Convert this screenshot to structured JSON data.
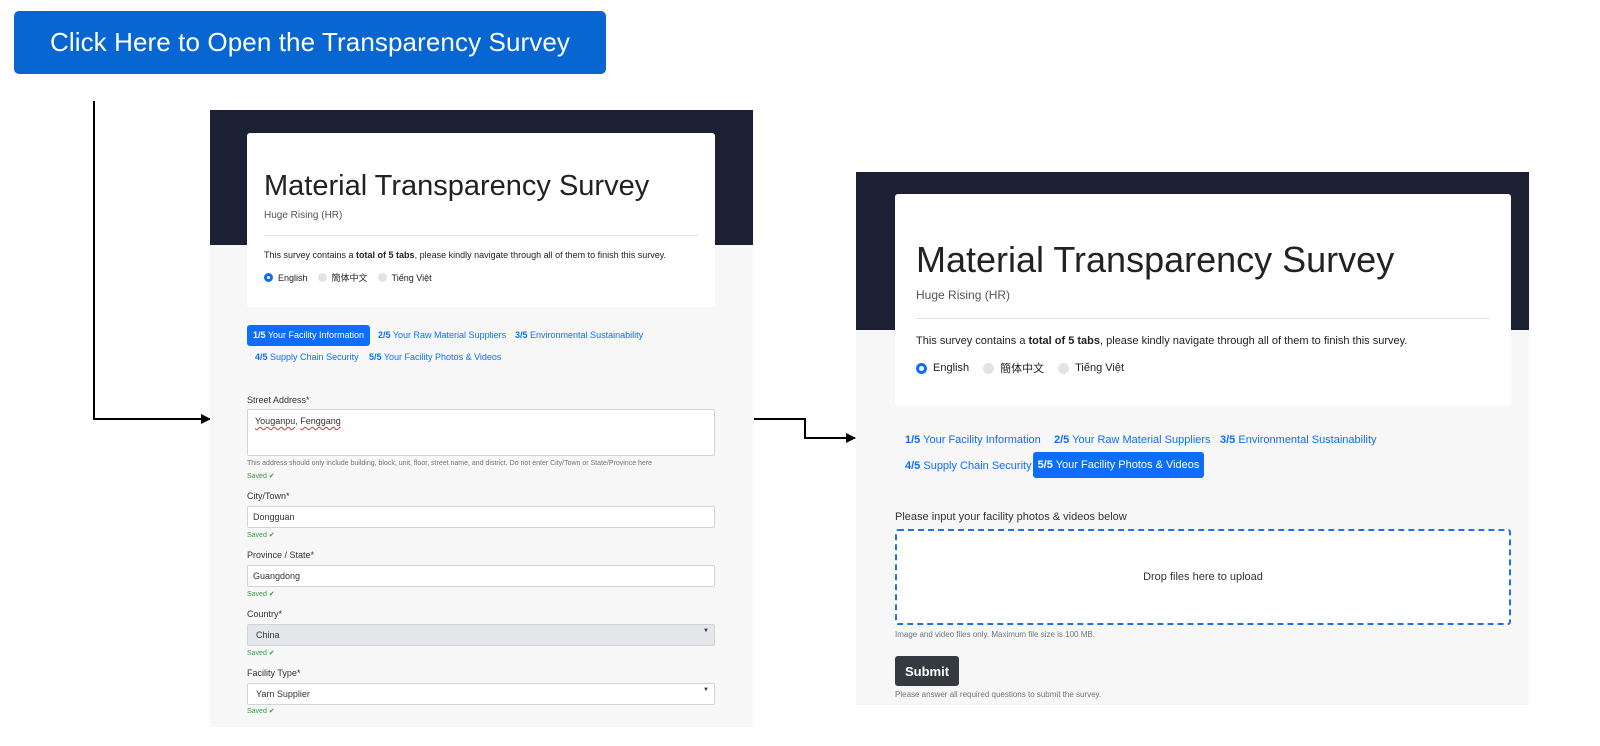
{
  "open_button": "Click Here to Open the Transparency Survey",
  "survey": {
    "title": "Material Transparency Survey",
    "company": "Huge Rising (HR)",
    "desc_prefix": "This survey contains a ",
    "desc_bold": "total of 5 tabs",
    "desc_suffix": ", please kindly navigate through all of them to finish this survey.",
    "languages": [
      {
        "label": "English",
        "selected": true
      },
      {
        "label": "簡体中文",
        "selected": false
      },
      {
        "label": "Tiếng Việt",
        "selected": false
      }
    ],
    "tabs": [
      {
        "num": "1/5",
        "label": "Your Facility Information"
      },
      {
        "num": "2/5",
        "label": "Your Raw Material Suppliers"
      },
      {
        "num": "3/5",
        "label": "Environmental Sustainability"
      },
      {
        "num": "4/5",
        "label": "Supply Chain Security"
      },
      {
        "num": "5/5",
        "label": "Your Facility Photos & Videos"
      }
    ]
  },
  "left_form": {
    "active_tab": "1/5",
    "street_label": "Street Address*",
    "street_word1": "Youganpu",
    "street_sep": ", ",
    "street_word2": "Fenggang",
    "street_help": "This address should only include building, block, unit, floor, street name, and district. Do not enter City/Town or State/Province here",
    "saved": "Saved ✔",
    "city_label": "City/Town*",
    "city_value": "Dongguan",
    "province_label": "Province / State*",
    "province_value": "Guangdong",
    "country_label": "Country*",
    "country_value": "China",
    "facility_label": "Facility Type*",
    "facility_value": "Yarn Supplier"
  },
  "right_form": {
    "active_tab": "5/5",
    "upload_label": "Please input your facility photos & videos below",
    "drop_text": "Drop files here to upload",
    "upload_help": "Image and video files only. Maximum file size is 100 MB.",
    "submit": "Submit",
    "submit_help": "Please answer all required questions to submit the survey."
  },
  "colors": {
    "primary": "#0d6efd",
    "header_band": "#1c2033",
    "cta": "#0766d1",
    "saved": "#2e9e46"
  }
}
